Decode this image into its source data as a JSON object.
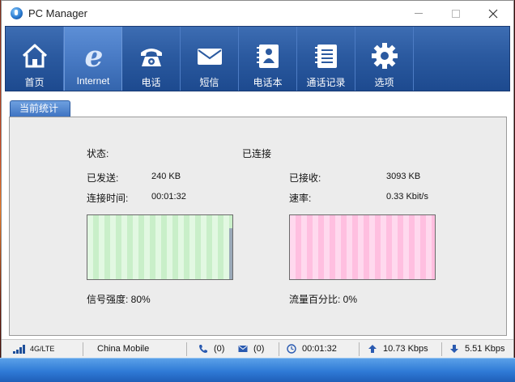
{
  "window": {
    "title": "PC Manager"
  },
  "toolbar": {
    "items": [
      {
        "label": "首页",
        "icon": "home-icon"
      },
      {
        "label": "Internet",
        "icon": "internet-icon"
      },
      {
        "label": "电话",
        "icon": "phone-icon"
      },
      {
        "label": "短信",
        "icon": "envelope-icon"
      },
      {
        "label": "电话本",
        "icon": "phonebook-icon"
      },
      {
        "label": "通话记录",
        "icon": "call-log-icon"
      },
      {
        "label": "选项",
        "icon": "gear-icon"
      }
    ],
    "active_index": 1
  },
  "tab": {
    "label": "当前统计"
  },
  "stats": {
    "status_label": "状态:",
    "status_value": "已连接",
    "sent_label": "已发送:",
    "sent_value": "240 KB",
    "received_label": "已接收:",
    "received_value": "3093 KB",
    "time_label": "连接时间:",
    "time_value": "00:01:32",
    "rate_label": "速率:",
    "rate_value": "0.33 Kbit/s",
    "signal_text": "信号强度: 80%",
    "signal_percent": 80,
    "traffic_text": "流量百分比: 0%",
    "traffic_percent": 0
  },
  "statusbar": {
    "network_type": "4G/LTE",
    "carrier": "China Mobile",
    "calls_count": "(0)",
    "sms_count": "(0)",
    "duration": "00:01:32",
    "upload_speed": "10.73 Kbps",
    "download_speed": "5.51 Kbps"
  },
  "colors": {
    "toolbar_blue": "#2b5aa0",
    "active_tab_blue": "#4a7cc6",
    "signal_bar_green": "#c9efc9",
    "traffic_bar_pink": "#ffbfe0"
  }
}
